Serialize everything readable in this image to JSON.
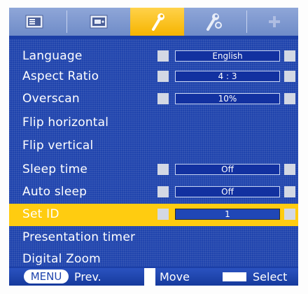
{
  "tabs": [
    {
      "icon": "picture-icon"
    },
    {
      "icon": "screen-icon"
    },
    {
      "icon": "wrench-icon"
    },
    {
      "icon": "wrench-gear-icon"
    },
    {
      "icon": "plus-icon"
    }
  ],
  "active_tab": 2,
  "menu": {
    "items": [
      {
        "label": "Language",
        "value": "English"
      },
      {
        "label": "Aspect Ratio",
        "value": "4 : 3"
      },
      {
        "label": "Overscan",
        "value": "10%"
      },
      {
        "label": "Flip horizontal"
      },
      {
        "label": "Flip vertical"
      },
      {
        "label": "Sleep time",
        "value": "Off"
      },
      {
        "label": "Auto sleep",
        "value": "Off"
      },
      {
        "label": "Set ID",
        "value": "1",
        "selected": true
      },
      {
        "label": "Presentation timer"
      },
      {
        "label": "Digital Zoom"
      }
    ]
  },
  "footer": {
    "menu_key": "MENU",
    "prev": "Prev.",
    "move": "Move",
    "select": "Select"
  },
  "colors": {
    "background": "#1f44ad",
    "highlight": "#ffcc10",
    "tab_bar": "#7e97cf"
  }
}
